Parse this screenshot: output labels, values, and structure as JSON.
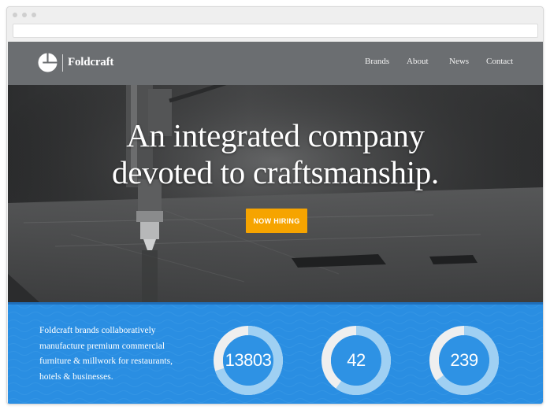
{
  "brand": {
    "name": "Foldcraft"
  },
  "nav": {
    "items": [
      "Brands",
      "About",
      "News",
      "Contact"
    ]
  },
  "hero": {
    "title_line1": "An integrated company",
    "title_line2": "devoted to craftsmanship.",
    "cta_label": "NOW HIRING"
  },
  "stats": {
    "description": "Foldcraft brands collaboratively manufacture premium commercial furniture & millwork for restaurants, hotels & businesses.",
    "items": [
      {
        "value": "13803"
      },
      {
        "value": "42"
      },
      {
        "value": "239"
      }
    ]
  },
  "colors": {
    "header": "#6b6e71",
    "cta": "#f6a400",
    "band": "#2a8ee2",
    "ring_light": "#9fd0f3",
    "ring_dark": "#efefef",
    "ring_inner": "#2e92e4"
  },
  "icons": {
    "logo": "foldcraft-logo-icon"
  }
}
